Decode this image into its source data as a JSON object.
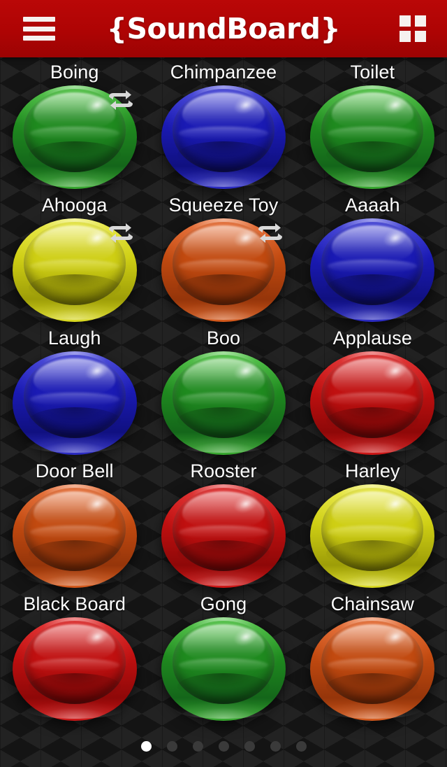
{
  "header": {
    "title": "{SoundBoard}",
    "menu_icon": "hamburger-menu-icon",
    "grid_icon": "grid-view-icon",
    "background_color": "#ae0404"
  },
  "colors": {
    "green": {
      "lite": "#46c23a",
      "base": "#1f8a1f",
      "dark": "#14661a",
      "dark2": "#0d4a12",
      "lite2": "#39aa30"
    },
    "blue": {
      "lite": "#3a3ad8",
      "base": "#1a1ab4",
      "dark": "#101080",
      "dark2": "#0a0a5c",
      "lite2": "#2c2cc4"
    },
    "yellow": {
      "lite": "#e8e83a",
      "base": "#cfcf14",
      "dark": "#9d9d08",
      "dark2": "#787804",
      "lite2": "#dcdc22"
    },
    "orange": {
      "lite": "#e8662a",
      "base": "#c24a10",
      "dark": "#95350a",
      "dark2": "#712605",
      "lite2": "#d65a1c"
    },
    "red": {
      "lite": "#e02020",
      "base": "#c01010",
      "dark": "#8e0808",
      "dark2": "#6b0505",
      "lite2": "#d01818"
    }
  },
  "pads": [
    [
      {
        "label": "Boing",
        "color": "green",
        "loop": true
      },
      {
        "label": "Chimpanzee",
        "color": "blue",
        "loop": false
      },
      {
        "label": "Toilet",
        "color": "green",
        "loop": false
      }
    ],
    [
      {
        "label": "Ahooga",
        "color": "yellow",
        "loop": true
      },
      {
        "label": "Squeeze Toy",
        "color": "orange",
        "loop": true
      },
      {
        "label": "Aaaah",
        "color": "blue",
        "loop": false
      }
    ],
    [
      {
        "label": "Laugh",
        "color": "blue",
        "loop": false
      },
      {
        "label": "Boo",
        "color": "green",
        "loop": false
      },
      {
        "label": "Applause",
        "color": "red",
        "loop": false
      }
    ],
    [
      {
        "label": "Door Bell",
        "color": "orange",
        "loop": false
      },
      {
        "label": "Rooster",
        "color": "red",
        "loop": false
      },
      {
        "label": "Harley",
        "color": "yellow",
        "loop": false
      }
    ],
    [
      {
        "label": "Black Board",
        "color": "red",
        "loop": false
      },
      {
        "label": "Gong",
        "color": "green",
        "loop": false
      },
      {
        "label": "Chainsaw",
        "color": "orange",
        "loop": false
      }
    ]
  ],
  "pager": {
    "count": 7,
    "active_index": 0,
    "active_color": "#ffffff",
    "inactive_color": "#3a3a3a"
  },
  "loop_icon_name": "repeat-loop-icon"
}
